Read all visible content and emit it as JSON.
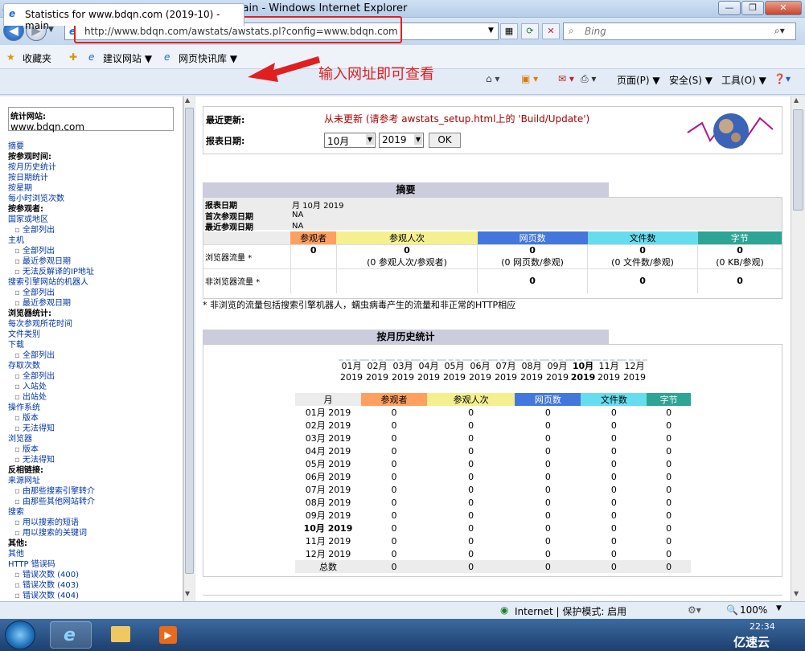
{
  "window": {
    "title": "Statistics for www.bdqn.com (2019-10) - main - Windows Internet Explorer"
  },
  "address": {
    "url": "http://www.bdqn.com/awstats/awstats.pl?config=www.bdqn.com",
    "search_placeholder": "Bing"
  },
  "favorites": {
    "fav": "收藏夹",
    "item1": "建议网站 ▼",
    "item2": "网页快讯库 ▼"
  },
  "tab": {
    "title": "Statistics for www.bdqn.com (2019-10) - main"
  },
  "annotation": "输入网址即可查看",
  "commandbar": {
    "page": "页面(P) ▼",
    "safety": "安全(S) ▼",
    "tools": "工具(O) ▼"
  },
  "sidebar": {
    "site_label": "统计网站:",
    "site_value": "www.bdqn.com",
    "items": [
      {
        "t": "摘要",
        "k": "l"
      },
      {
        "t": "按参观时间:",
        "k": "b"
      },
      {
        "t": "按月历史统计",
        "k": "l"
      },
      {
        "t": "按日期统计",
        "k": "l"
      },
      {
        "t": "按星期",
        "k": "l"
      },
      {
        "t": "每小时浏览次数",
        "k": "l"
      },
      {
        "t": "按参观者:",
        "k": "b"
      },
      {
        "t": "国家或地区",
        "k": "l"
      },
      {
        "t": "全部列出",
        "k": "i"
      },
      {
        "t": "主机",
        "k": "l"
      },
      {
        "t": "全部列出",
        "k": "i"
      },
      {
        "t": "最近参观日期",
        "k": "i"
      },
      {
        "t": "无法反解译的IP地址",
        "k": "i"
      },
      {
        "t": "搜索引擎网站的机器人",
        "k": "l"
      },
      {
        "t": "全部列出",
        "k": "i"
      },
      {
        "t": "最近参观日期",
        "k": "i"
      },
      {
        "t": "浏览器统计:",
        "k": "b"
      },
      {
        "t": "每次参观所花时间",
        "k": "l"
      },
      {
        "t": "文件类别",
        "k": "l"
      },
      {
        "t": "下载",
        "k": "l"
      },
      {
        "t": "全部列出",
        "k": "i"
      },
      {
        "t": "存取次数",
        "k": "l"
      },
      {
        "t": "全部列出",
        "k": "i"
      },
      {
        "t": "入站处",
        "k": "i"
      },
      {
        "t": "出站处",
        "k": "i"
      },
      {
        "t": "操作系统",
        "k": "l"
      },
      {
        "t": "版本",
        "k": "i"
      },
      {
        "t": "无法得知",
        "k": "i"
      },
      {
        "t": "浏览器",
        "k": "l"
      },
      {
        "t": "版本",
        "k": "i"
      },
      {
        "t": "无法得知",
        "k": "i"
      },
      {
        "t": "反相链接:",
        "k": "b"
      },
      {
        "t": "来源网址",
        "k": "l"
      },
      {
        "t": "由那些搜索引擎转介",
        "k": "i"
      },
      {
        "t": "由那些其他网站转介",
        "k": "i"
      },
      {
        "t": "搜索",
        "k": "l"
      },
      {
        "t": "用以搜索的短语",
        "k": "i"
      },
      {
        "t": "用以搜索的关键词",
        "k": "i"
      },
      {
        "t": "其他:",
        "k": "b"
      },
      {
        "t": "其他",
        "k": "l"
      },
      {
        "t": "HTTP 错误码",
        "k": "l"
      },
      {
        "t": "错误次数 (400)",
        "k": "i"
      },
      {
        "t": "错误次数 (403)",
        "k": "i"
      },
      {
        "t": "错误次数 (404)",
        "k": "i"
      }
    ]
  },
  "header": {
    "last_update_label": "最近更新:",
    "last_update_value": "从未更新 (请参考 awstats_setup.html上的 'Build/Update')",
    "report_date_label": "报表日期:",
    "month": "10月",
    "year": "2019",
    "ok": "OK"
  },
  "summary": {
    "title": "摘要",
    "report_date_label": "报表日期",
    "report_date_value": "月 10月 2019",
    "first_visit_label": "首次参观日期",
    "first_visit_value": "NA",
    "last_visit_label": "最近参观日期",
    "last_visit_value": "NA",
    "cols": [
      "参观者",
      "参观人次",
      "网页数",
      "文件数",
      "字节"
    ],
    "row1_label": "浏览器流量 *",
    "row1": [
      "0",
      "0",
      "0",
      "0",
      "0"
    ],
    "row1_sub": [
      "",
      "(0 参观人次/参观者)",
      "(0 网页数/参观)",
      "(0 文件数/参观)",
      "(0 KB/参观)"
    ],
    "row2_label": "非浏览器流量 *",
    "row2": [
      "",
      "",
      "0",
      "0",
      "0"
    ],
    "note": "* 非浏览的流量包括搜索引擎机器人，蠕虫病毒产生的流量和非正常的HTTP相应"
  },
  "monthly": {
    "title": "按月历史统计",
    "months": [
      "01月",
      "02月",
      "03月",
      "04月",
      "05月",
      "06月",
      "07月",
      "08月",
      "09月",
      "10月",
      "11月",
      "12月"
    ],
    "year": "2019",
    "col_month": "月",
    "cols": [
      "参观者",
      "参观人次",
      "网页数",
      "文件数",
      "字节"
    ],
    "rows": [
      "01月 2019",
      "02月 2019",
      "03月 2019",
      "04月 2019",
      "05月 2019",
      "06月 2019",
      "07月 2019",
      "08月 2019",
      "09月 2019",
      "10月 2019",
      "11月 2019",
      "12月 2019"
    ],
    "total": "总数",
    "zero": "0"
  },
  "status": {
    "zone": "Internet | 保护模式: 启用",
    "zoom": "100%"
  },
  "taskbar": {
    "time": "22:34",
    "watermark": "亿速云"
  },
  "colors": {
    "visitors": "#ffa060",
    "visits": "#f4f090",
    "pages": "#4477dd",
    "files": "#66ddee",
    "bytes": "#2ea495",
    "section": "#ccccdd",
    "annot": "#e02020"
  }
}
